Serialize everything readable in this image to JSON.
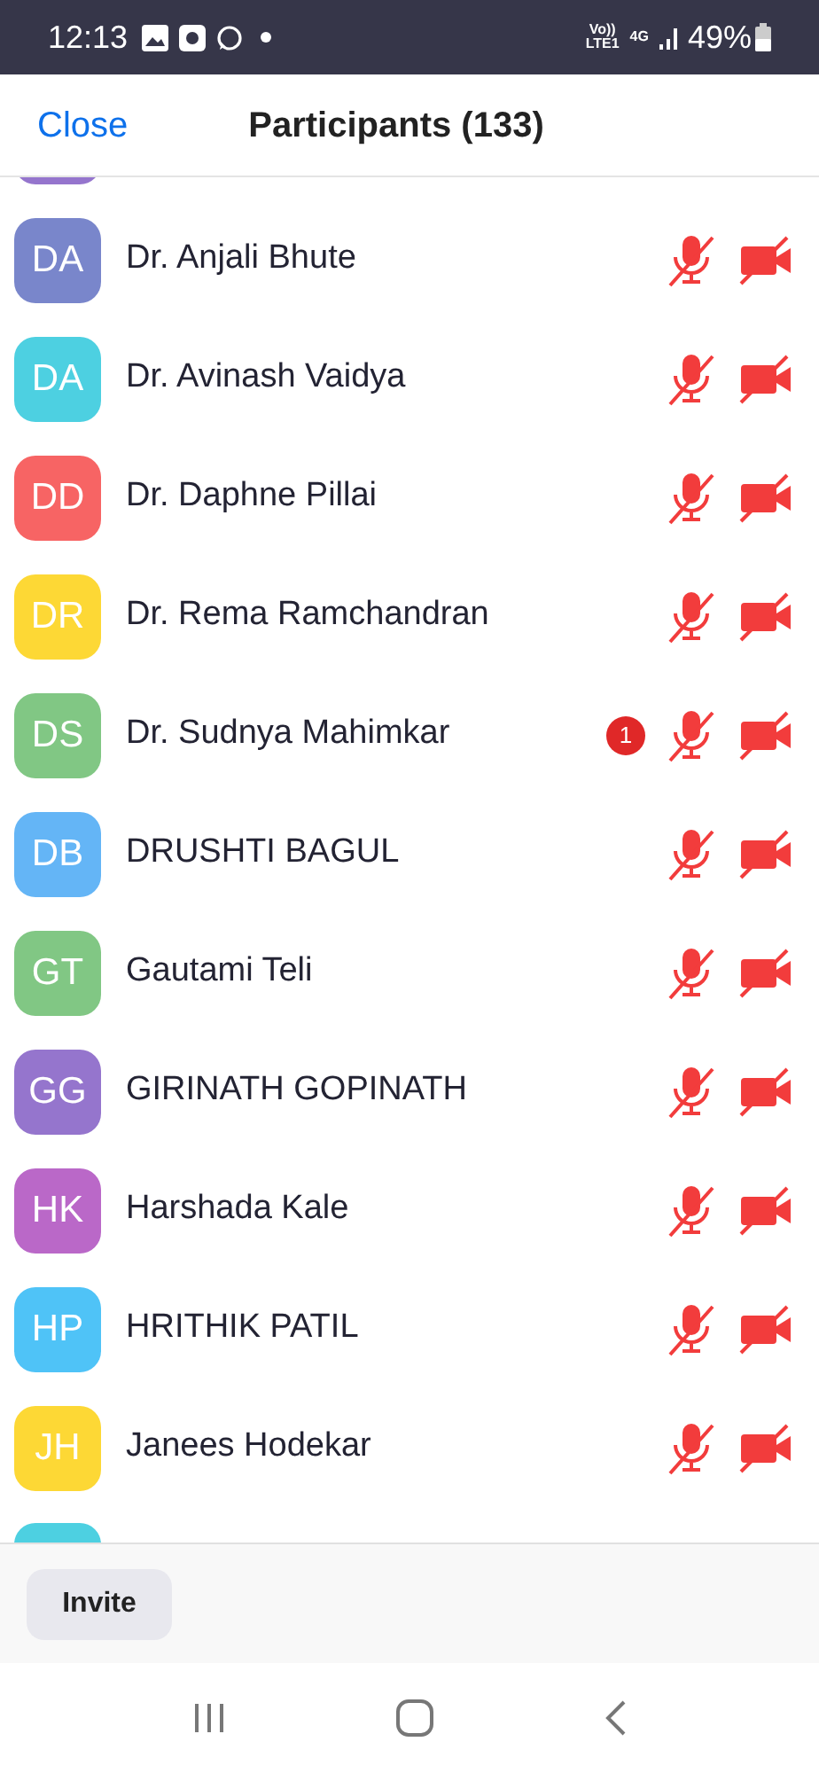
{
  "status_bar": {
    "time": "12:13",
    "network_top": "Vo))",
    "network_bottom": "LTE1",
    "data_type": "4G",
    "battery": "49%"
  },
  "header": {
    "close": "Close",
    "title": "Participants (133)"
  },
  "cut_off_rows": [
    {
      "color": "#9575cd"
    },
    {
      "color": "#4dd0e1"
    }
  ],
  "participants": [
    {
      "initials": "DA",
      "name": "Dr. Anjali Bhute",
      "color": "#7986cb",
      "muted": true,
      "video_off": true
    },
    {
      "initials": "DA",
      "name": "Dr. Avinash Vaidya",
      "color": "#4dd0e1",
      "muted": true,
      "video_off": true
    },
    {
      "initials": "DD",
      "name": "Dr. Daphne Pillai",
      "color": "#f76464",
      "muted": true,
      "video_off": true
    },
    {
      "initials": "DR",
      "name": "Dr. Rema Ramchandran",
      "color": "#fdd835",
      "muted": true,
      "video_off": true
    },
    {
      "initials": "DS",
      "name": "Dr. Sudnya Mahimkar",
      "color": "#81c784",
      "muted": true,
      "video_off": true,
      "badge": "1"
    },
    {
      "initials": "DB",
      "name": "DRUSHTI BAGUL",
      "color": "#64b5f6",
      "muted": true,
      "video_off": true
    },
    {
      "initials": "GT",
      "name": "Gautami Teli",
      "color": "#81c784",
      "muted": true,
      "video_off": true
    },
    {
      "initials": "GG",
      "name": "GIRINATH GOPINATH",
      "color": "#9575cd",
      "muted": true,
      "video_off": true
    },
    {
      "initials": "HK",
      "name": "Harshada Kale",
      "color": "#ba68c8",
      "muted": true,
      "video_off": true
    },
    {
      "initials": "HP",
      "name": "HRITHIK PATIL",
      "color": "#4fc3f7",
      "muted": true,
      "video_off": true
    },
    {
      "initials": "JH",
      "name": "Janees Hodekar",
      "color": "#fdd835",
      "muted": true,
      "video_off": true
    }
  ],
  "footer": {
    "invite": "Invite"
  }
}
